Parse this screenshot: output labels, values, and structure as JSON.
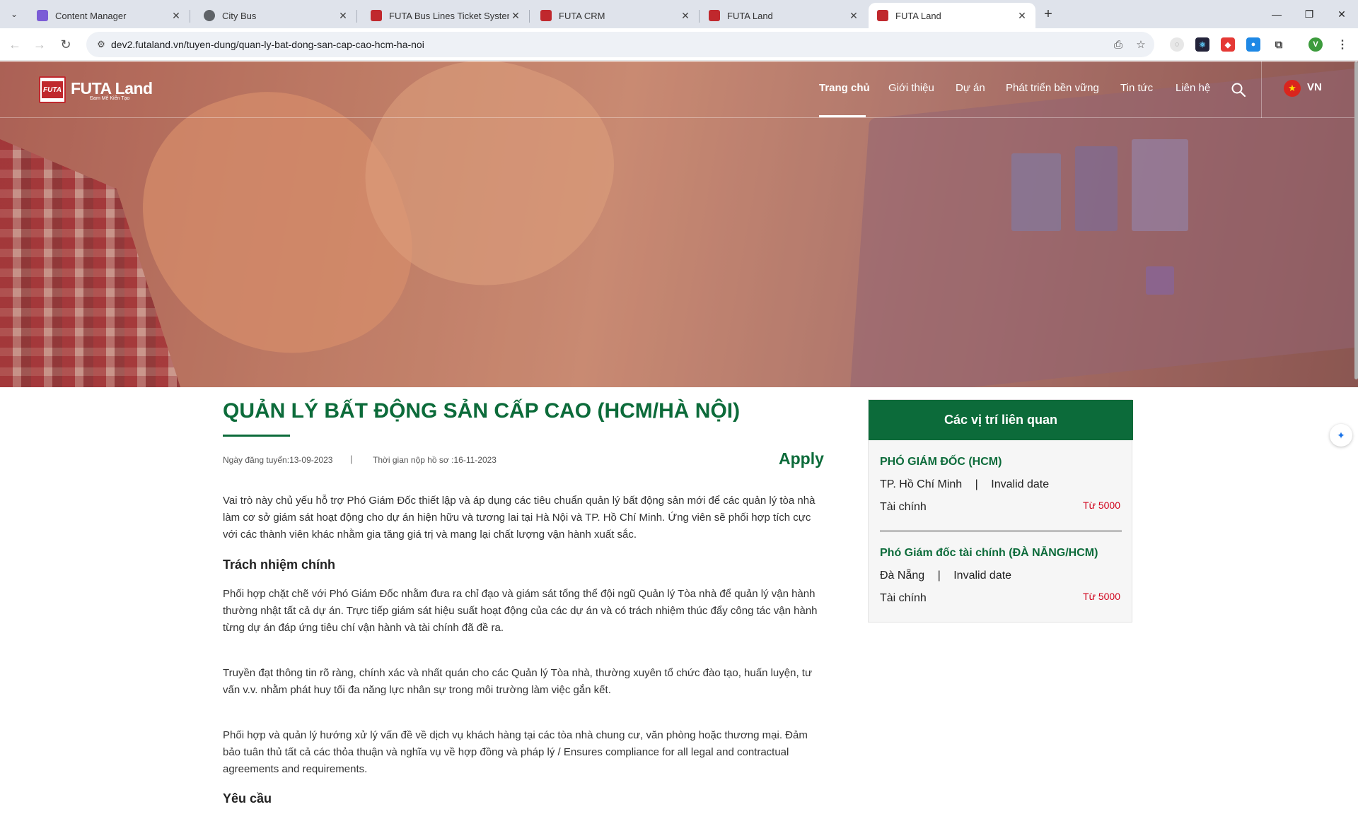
{
  "browser": {
    "tabs": [
      {
        "title": "Content Manager",
        "favicon_color": "#7b5cd6",
        "active": false
      },
      {
        "title": "City Bus",
        "favicon_color": "#5f6368",
        "active": false
      },
      {
        "title": "FUTA Bus Lines Ticket System",
        "favicon_color": "#c0282d",
        "active": false
      },
      {
        "title": "FUTA CRM",
        "favicon_color": "#c0282d",
        "active": false
      },
      {
        "title": "FUTA Land",
        "favicon_color": "#c0282d",
        "active": false
      },
      {
        "title": "FUTA Land",
        "favicon_color": "#c0282d",
        "active": true
      }
    ],
    "url": "dev2.futaland.vn/tuyen-dung/quan-ly-bat-dong-san-cap-cao-hcm-ha-noi",
    "profile_initial": "V"
  },
  "site": {
    "logo_mark": "FUTA",
    "logo_text": "FUTA Land",
    "slogan": "Đam Mê Kiến Tạo",
    "nav": [
      "Trang chủ",
      "Giới thiệu",
      "Dự án",
      "Phát triển bền vững",
      "Tin tức",
      "Liên hệ"
    ],
    "active_nav": "Trang chủ",
    "language": "VN"
  },
  "job": {
    "title": "QUẢN LÝ BẤT ĐỘNG SẢN CẤP CAO (HCM/HÀ NỘI)",
    "posted": "Ngày đăng tuyển:13-09-2023",
    "separator": "|",
    "deadline": "Thời gian nộp hồ sơ :16-11-2023",
    "apply_label": "Apply",
    "intro": "Vai trò này chủ yếu hỗ trợ Phó Giám Đốc thiết lập và áp dụng các tiêu chuẩn quản lý bất động sản mới để các quản lý tòa nhà làm cơ sở giám sát hoạt động cho dự án hiện hữu và tương lai tại Hà Nội và TP. Hồ Chí Minh. Ứng viên sẽ phối hợp tích cực với các thành viên khác nhằm gia tăng giá trị và mang lại chất lượng vận hành xuất sắc.",
    "responsibilities_heading": "Trách nhiệm chính",
    "responsibilities": [
      "Phối hợp chặt chẽ với Phó Giám Đốc nhằm đưa ra chỉ đạo và giám sát tổng thể đội ngũ Quản lý Tòa nhà để quản lý vận hành thường nhật tất cả dự án. Trực tiếp giám sát hiệu suất hoạt động của các dự án và có trách nhiệm thúc đẩy công tác vận hành từng dự án đáp ứng tiêu chí vận hành và tài chính đã đề ra.",
      "Truyền đạt thông tin rõ ràng, chính xác và nhất quán cho các Quản lý Tòa nhà, thường xuyên tổ chức đào tạo, huấn luyện, tư vấn v.v. nhằm phát huy tối đa năng lực nhân sự trong môi trường làm việc gắn kết.",
      "Phối hợp và quản lý hướng xử lý vấn đề về dịch vụ khách hàng tại các tòa nhà chung cư, văn phòng hoặc thương mại. Đảm bảo tuân thủ tất cả các thỏa thuận và nghĩa vụ về hợp đồng và pháp lý / Ensures compliance for all legal and contractual agreements and requirements."
    ],
    "requirements_heading": "Yêu cầu"
  },
  "related": {
    "heading": "Các vị trí liên quan",
    "items": [
      {
        "title": "PHÓ GIÁM ĐỐC (HCM)",
        "location": "TP. Hồ Chí Minh",
        "sep": "|",
        "date": "Invalid date",
        "department": "Tài chính",
        "salary": "Từ 5000"
      },
      {
        "title": "Phó Giám đốc tài chính (ĐÀ NẴNG/HCM)",
        "location": "Đà Nẵng",
        "sep": "|",
        "date": "Invalid date",
        "department": "Tài chính",
        "salary": "Từ 5000"
      }
    ]
  },
  "colors": {
    "brand_green": "#0c6b3a",
    "salary_red": "#d0021b",
    "logo_red": "#c0282d"
  }
}
